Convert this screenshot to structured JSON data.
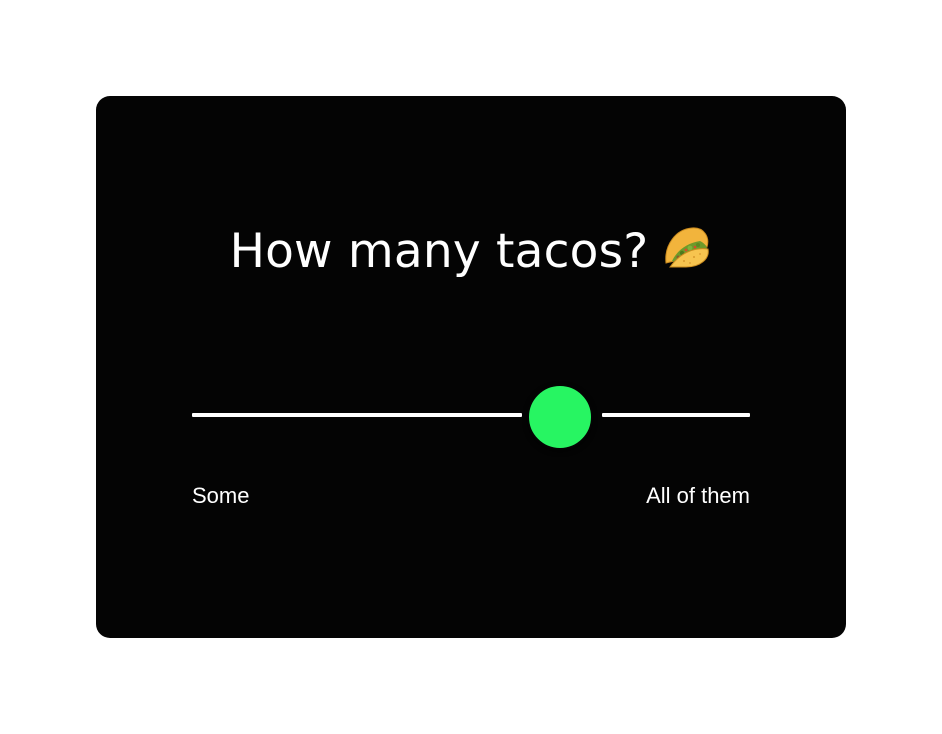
{
  "question": {
    "title": "How many tacos?",
    "emoji_icon": "taco-icon"
  },
  "slider": {
    "min_label": "Some",
    "max_label": "All of them",
    "value_fraction": 0.66
  },
  "colors": {
    "card_background": "#040404",
    "thumb": "#27f562",
    "track": "#ffffff",
    "text": "#ffffff",
    "page_background": "#ffffff"
  }
}
